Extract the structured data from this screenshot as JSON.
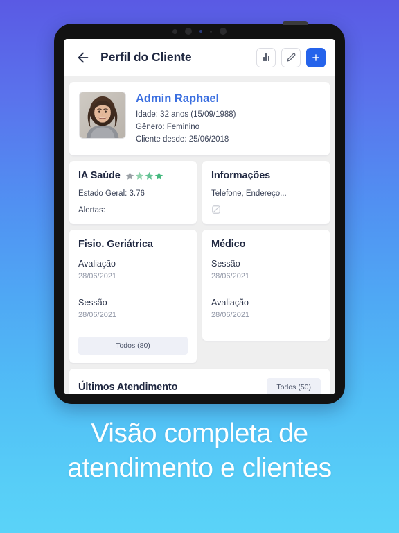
{
  "appbar": {
    "back_icon": "arrow-left-icon",
    "title": "Perfil do Cliente",
    "actions": [
      {
        "name": "chart-button",
        "icon": "bar-chart-icon"
      },
      {
        "name": "edit-button",
        "icon": "pencil-icon"
      },
      {
        "name": "add-button",
        "icon": "plus-icon",
        "label": "+"
      }
    ]
  },
  "profile": {
    "avatar_alt": "avatar",
    "name": "Admin Raphael",
    "age_line": "Idade: 32 anos (15/09/1988)",
    "gender_line": "Gênero: Feminino",
    "since_line": "Cliente desde: 25/06/2018"
  },
  "health_card": {
    "title": "IA Saúde",
    "rating_stars": 4,
    "star_colors": [
      "#9aa0a6",
      "#8ed1ab",
      "#63c294",
      "#45b97f"
    ],
    "state_line": "Estado Geral: 3.76",
    "alerts_line": "Alertas:"
  },
  "info_card": {
    "title": "Informações",
    "subtitle": "Telefone, Endereço...",
    "status_icon": "no-data-icon"
  },
  "service_cards": [
    {
      "title": "Fisio. Geriátrica",
      "items": [
        {
          "label": "Avaliação",
          "date": "28/06/2021"
        },
        {
          "label": "Sessão",
          "date": "28/06/2021"
        }
      ],
      "button_label": "Todos (80)"
    },
    {
      "title": "Médico",
      "items": [
        {
          "label": "Sessão",
          "date": "28/06/2021"
        },
        {
          "label": "Avaliação",
          "date": "28/06/2021"
        }
      ],
      "button_label": ""
    }
  ],
  "last_card": {
    "title": "Últimos Atendimento",
    "button_label": "Todos (50)"
  },
  "caption": {
    "line1": "Visão completa de",
    "line2": "atendimento e clientes"
  },
  "colors": {
    "accent_blue": "#2563eb",
    "name_blue": "#3b6fe0",
    "text_dark": "#1f2740",
    "muted": "#9096a6",
    "bg_gradient_top": "#5a5ae4",
    "bg_gradient_bottom": "#5ad3f8",
    "screen_bg": "#efefef"
  }
}
